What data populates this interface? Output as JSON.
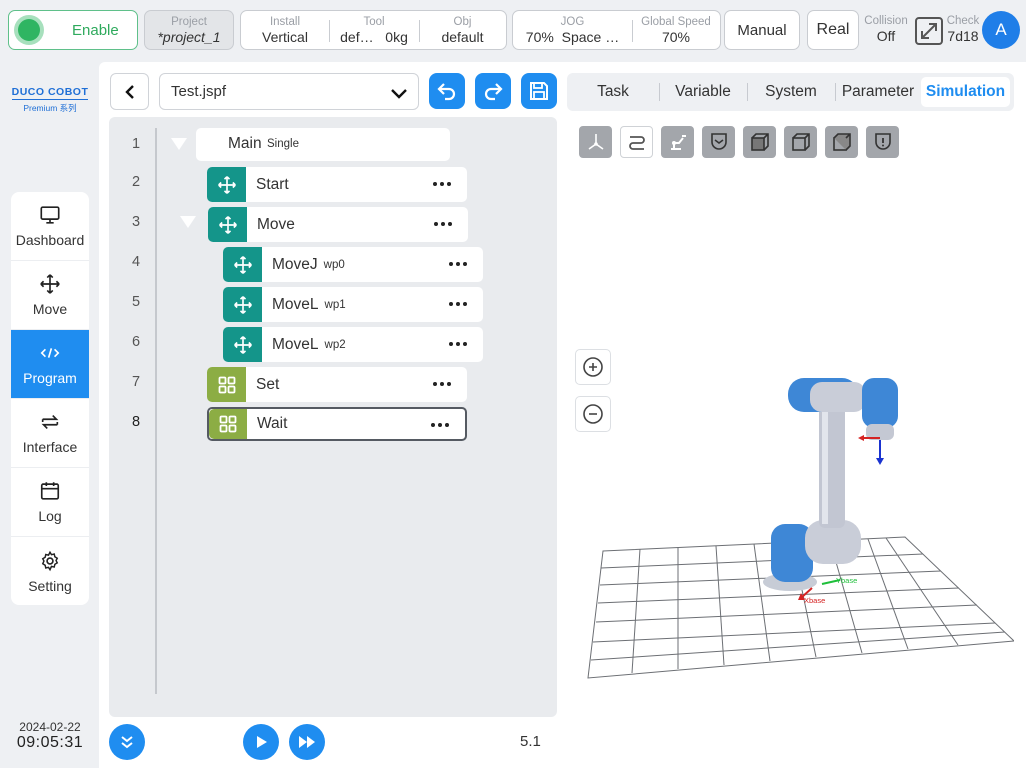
{
  "topbar": {
    "enable_label": "Enable",
    "project": {
      "title": "Project",
      "value": "*project_1"
    },
    "install": {
      "title": "Install",
      "value": "Vertical"
    },
    "tool": {
      "title": "Tool",
      "value": "def…",
      "value2": "0kg"
    },
    "obj": {
      "title": "Obj",
      "value": "default"
    },
    "jog": {
      "title": "JOG",
      "value": "70%",
      "value2": "Space …"
    },
    "speed": {
      "title": "Global Speed",
      "value": "70%"
    },
    "manual_label": "Manual",
    "real_label": "Real",
    "collision": {
      "title": "Collision",
      "value": "Off"
    },
    "check": {
      "title": "Check",
      "value": "7d18"
    },
    "avatar_letter": "A"
  },
  "logo": {
    "brand": "DUCO COBOT",
    "sub": "Premium 系列"
  },
  "nav": {
    "items": [
      {
        "label": "Dashboard",
        "icon": "monitor-icon"
      },
      {
        "label": "Move",
        "icon": "move-arrows-icon"
      },
      {
        "label": "Program",
        "icon": "code-icon",
        "active": true
      },
      {
        "label": "Interface",
        "icon": "swap-icon"
      },
      {
        "label": "Log",
        "icon": "calendar-icon"
      },
      {
        "label": "Setting",
        "icon": "gear-icon"
      }
    ]
  },
  "datetime": {
    "date": "2024-02-22",
    "time": "09:05:31"
  },
  "file": {
    "name": "Test.jspf"
  },
  "tabs": [
    {
      "label": "Task"
    },
    {
      "label": "Variable"
    },
    {
      "label": "System"
    },
    {
      "label": "Parameter"
    },
    {
      "label": "Simulation",
      "active": true
    }
  ],
  "program": {
    "line_numbers": [
      "1",
      "2",
      "3",
      "4",
      "5",
      "6",
      "7",
      "8"
    ],
    "main": {
      "label": "Main",
      "sub": "Single"
    },
    "nodes": [
      {
        "label": "Start",
        "sub": ""
      },
      {
        "label": "Move",
        "sub": ""
      },
      {
        "label": "MoveJ",
        "sub": "wp0"
      },
      {
        "label": "MoveL",
        "sub": "wp1"
      },
      {
        "label": "MoveL",
        "sub": "wp2"
      },
      {
        "label": "Set",
        "sub": ""
      },
      {
        "label": "Wait",
        "sub": ""
      }
    ]
  },
  "simulation": {
    "axis_labels": {
      "x": "Xbase",
      "y": "Ybase"
    }
  },
  "footer": {
    "version": "5.1"
  },
  "colors": {
    "accent": "#1f8df0",
    "teal_node": "#14958a",
    "olive_node": "#8cad44",
    "enable_green": "#2fb562"
  }
}
